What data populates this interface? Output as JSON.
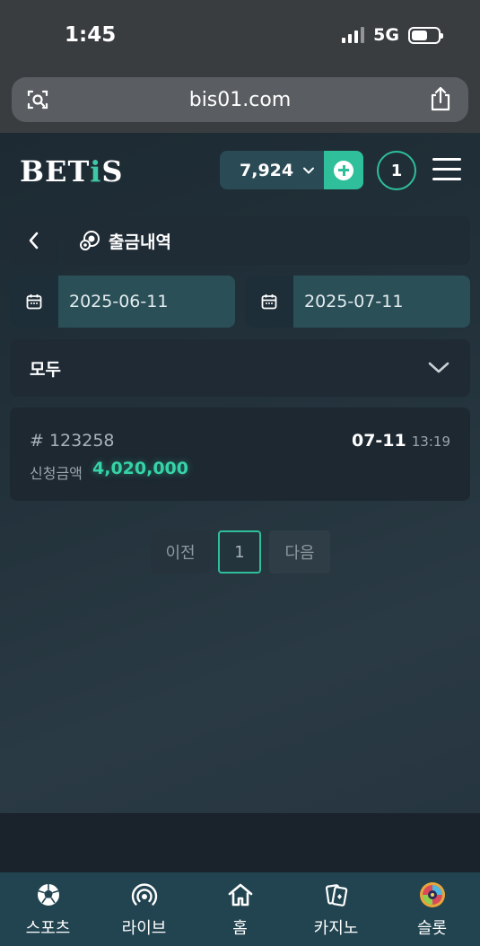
{
  "status_bar": {
    "time": "1:45",
    "network": "5G"
  },
  "browser": {
    "url": "bis01.com"
  },
  "header": {
    "logo_prefix": "BET",
    "logo_accent": "i",
    "logo_suffix": "S",
    "balance": "7,924",
    "notification_count": "1"
  },
  "page": {
    "title": "출금내역",
    "date_from": "2025-06-11",
    "date_to": "2025-07-11",
    "filter_selected": "모두"
  },
  "records": [
    {
      "id": "# 123258",
      "label": "신청금액",
      "amount": "4,020,000",
      "date": "07-11",
      "time": "13:19"
    }
  ],
  "pagination": {
    "prev": "이전",
    "current": "1",
    "next": "다음"
  },
  "bottom_nav": [
    {
      "label": "스포츠",
      "icon": "soccer-ball-icon"
    },
    {
      "label": "라이브",
      "icon": "broadcast-icon"
    },
    {
      "label": "홈",
      "icon": "home-icon"
    },
    {
      "label": "카지노",
      "icon": "cards-icon"
    },
    {
      "label": "슬롯",
      "icon": "slot-wheel-icon"
    }
  ],
  "colors": {
    "accent": "#2fbf9a",
    "amount": "#36d3a7",
    "nav_bg": "#224450"
  }
}
